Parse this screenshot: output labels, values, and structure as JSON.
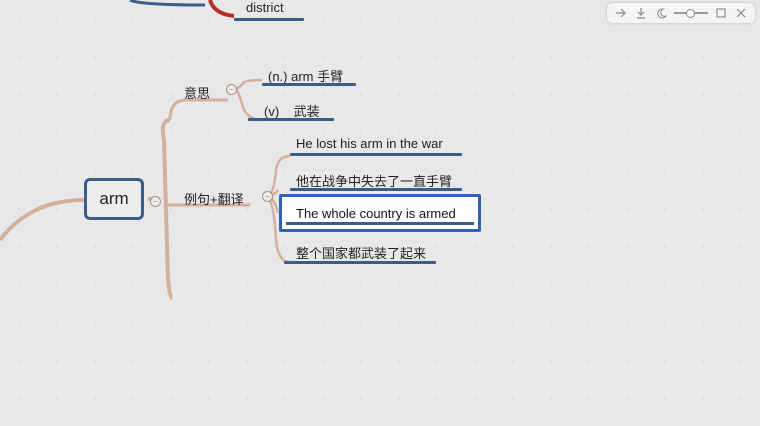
{
  "mindmap": {
    "top_fragment": "district",
    "central_topic": "arm",
    "branches": [
      {
        "label": "意思",
        "children": [
          "(n.) arm 手臂",
          "(v)    武装"
        ]
      },
      {
        "label": "例句+翻译",
        "children": [
          "He lost his arm in the war",
          "他在战争中失去了一直手臂",
          "The whole country is armed",
          "整个国家都武装了起来"
        ]
      }
    ],
    "selected_node": "The whole country is armed",
    "collapse_symbol": "−"
  },
  "toolbar": {
    "icons": [
      "arrow-right-icon",
      "download-icon",
      "moon-icon",
      "zoom-slider",
      "window-icon",
      "close-icon"
    ]
  },
  "colors": {
    "branch": "#d3b09e",
    "underline": "#3c5a8c",
    "selection": "#2f62b8",
    "red_branch": "#b0302b"
  }
}
